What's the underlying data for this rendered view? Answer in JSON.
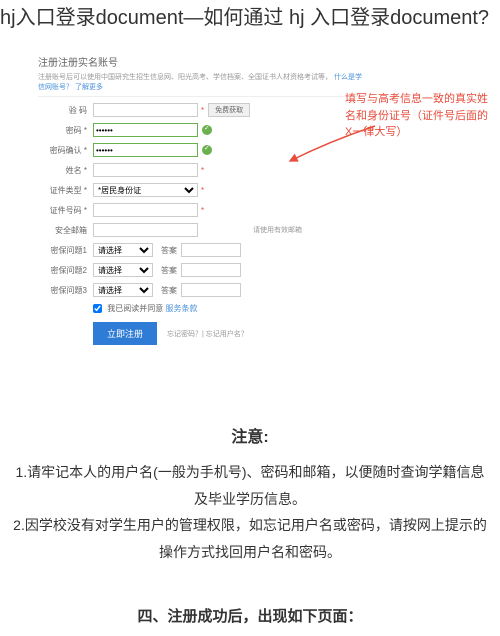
{
  "header": {
    "title": "hj入口登录document—如何通过 hj 入口登录document?"
  },
  "form": {
    "card_title": "注册注册实名账号",
    "card_subtitle_prefix": "注册账号后可以使用中国研究生招生信息网、阳光高考、学信档案、全国证书人材资格考试等，",
    "card_subtitle_link1": "什么是学信网账号？",
    "card_subtitle_link2": "了解更多",
    "verify_label": "验 码",
    "verify_btn": "免费获取",
    "password_label": "密码 *",
    "confirm_label": "密码确认 *",
    "name_label": "姓名 *",
    "idtype_label": "证件类型 *",
    "idtype_value": "*居民身份证",
    "idnum_label": "证件号码 *",
    "email_label": "安全邮箱",
    "email_hint": "请使用有效邮箱",
    "sec1_label": "密保问题1",
    "sec1_value": "请选择",
    "sec2_label": "密保问题2",
    "sec2_value": "请选择",
    "sec3_label": "密保问题3",
    "sec3_value": "请选择",
    "answer_label": "答案",
    "agree_prefix": "我已阅读并同意",
    "agree_link": "服务条款",
    "submit": "立即注册",
    "forgot": "忘记密码？| 忘记用户名？"
  },
  "annotation": {
    "text": "填写与高考信息一致的真实姓名和身份证号（证件号后面的X一律大写）"
  },
  "notice": {
    "title": "注意:",
    "item1": "1.请牢记本人的用户名(一般为手机号)、密码和邮箱，以便随时查询学籍信息及毕业学历信息。",
    "item2": "2.因学校没有对学生用户的管理权限，如忘记用户名或密码，请按网上提示的操作方式找回用户名和密码。"
  },
  "section_four": "四、注册成功后，出现如下页面："
}
